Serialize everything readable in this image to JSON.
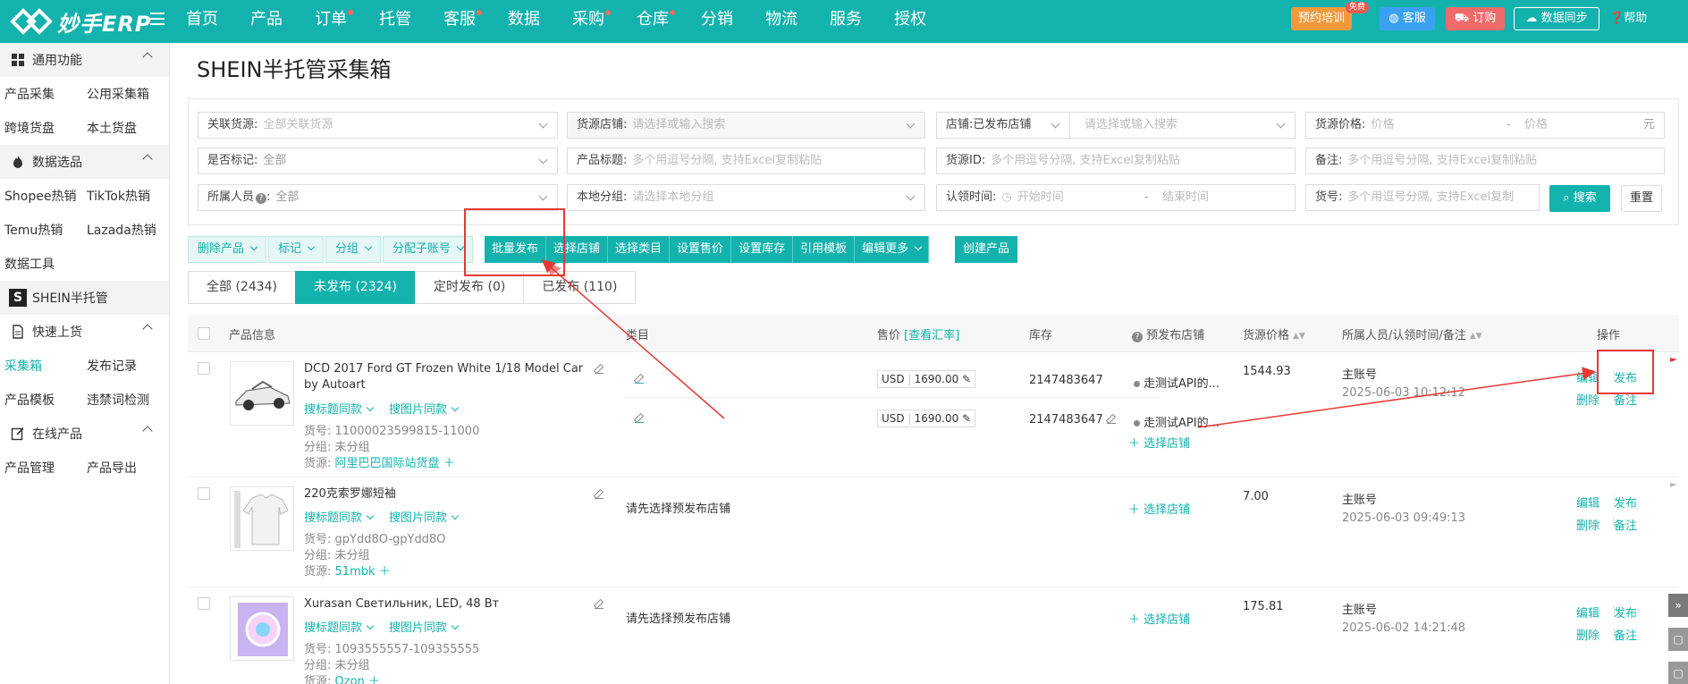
{
  "header": {
    "logo_text": "妙手ERP",
    "nav": [
      {
        "label": "首页",
        "dot": false
      },
      {
        "label": "产品",
        "dot": false
      },
      {
        "label": "订单",
        "dot": true
      },
      {
        "label": "托管",
        "dot": false
      },
      {
        "label": "客服",
        "dot": true
      },
      {
        "label": "数据",
        "dot": false
      },
      {
        "label": "采购",
        "dot": true
      },
      {
        "label": "仓库",
        "dot": true
      },
      {
        "label": "分销",
        "dot": false
      },
      {
        "label": "物流",
        "dot": false
      },
      {
        "label": "服务",
        "dot": false
      },
      {
        "label": "授权",
        "dot": false
      }
    ],
    "training_label": "预约培训",
    "free_badge": "免费",
    "kefu_label": "客服",
    "order_label": "订购",
    "sync_label": "数据同步",
    "help_label": "帮助"
  },
  "sidebar": {
    "group_common": "通用功能",
    "row1": [
      "产品采集",
      "公用采集箱"
    ],
    "row2": [
      "跨境货盘",
      "本土货盘"
    ],
    "group_data": "数据选品",
    "row3": [
      "Shopee热销",
      "TikTok热销"
    ],
    "row4": [
      "Temu热销",
      "Lazada热销"
    ],
    "data_tools": "数据工具",
    "shein_label": "SHEIN半托管",
    "shein_logo": "S",
    "group_upload": "快速上货",
    "row5": [
      "采集箱",
      "发布记录"
    ],
    "row6": [
      "产品模板",
      "违禁词检测"
    ],
    "group_online": "在线产品",
    "row7": [
      "产品管理",
      "产品导出"
    ]
  },
  "page": {
    "title": "SHEIN半托管采集箱"
  },
  "filters": {
    "source": {
      "label": "关联货源:",
      "value": "全部关联货源"
    },
    "source_shop": {
      "label": "货源店铺:",
      "placeholder": "请选择或输入搜索"
    },
    "shop": {
      "label": "店铺:",
      "value": "已发布店铺",
      "placeholder": "请选择或输入搜索"
    },
    "source_price": {
      "label": "货源价格:",
      "min_ph": "价格",
      "dash": "-",
      "max_ph": "价格",
      "unit": "元"
    },
    "marked": {
      "label": "是否标记:",
      "value": "全部"
    },
    "product_title": {
      "label": "产品标题:",
      "placeholder": "多个用逗号分隔, 支持Excel复制粘贴"
    },
    "source_id": {
      "label": "货源ID:",
      "placeholder": "多个用逗号分隔, 支持Excel复制粘贴"
    },
    "remark": {
      "label": "备注:",
      "placeholder": "多个用逗号分隔, 支持Excel复制粘贴"
    },
    "owner": {
      "label": "所属人员",
      "value": "全部"
    },
    "local_group": {
      "label": "本地分组:",
      "placeholder": "请选择本地分组"
    },
    "claim_time": {
      "label": "认领时间:",
      "start_ph": "开始时间",
      "dash": "-",
      "end_ph": "结束时间"
    },
    "sku": {
      "label": "货号:",
      "placeholder": "多个用逗号分隔, 支持Excel复制"
    },
    "search_label": "搜索",
    "reset_label": "重置"
  },
  "toolbar": {
    "light": [
      "删除产品",
      "标记",
      "分组",
      "分配子账号"
    ],
    "solid": [
      "批量发布",
      "选择店铺",
      "选择类目",
      "设置售价",
      "设置库存",
      "引用模板",
      "编辑更多"
    ],
    "create_label": "创建产品"
  },
  "tabs": [
    "全部 (2434)",
    "未发布 (2324)",
    "定时发布 (0)",
    "已发布 (110)"
  ],
  "columns": {
    "product": "产品信息",
    "category": "类目",
    "price": "售价",
    "rate_link": "[查看汇率]",
    "stock": "库存",
    "pre_shop": "预发布店铺",
    "source_price": "货源价格",
    "owner": "所属人员/认领时间/备注",
    "ops": "操作"
  },
  "rows": [
    {
      "title_line1": "DCD 2017 Ford GT Frozen White 1/18 Model Car",
      "title_line2": "by Autoart",
      "search_title": "搜标题同款",
      "search_image": "搜图片同款",
      "sku": "货号: 11000023599815-11000",
      "group": "分组: 未分组",
      "source_label": "货源:",
      "source_name": "阿里巴巴国际站货盘",
      "currency": "USD",
      "price": "1690.00",
      "stock": "2147483647",
      "shop_name": "走测试API的...",
      "select_shop": "选择店铺",
      "source_price": "1544.93",
      "owner": "主账号",
      "time": "2025-06-03 10:12:12",
      "ops": [
        "编辑",
        "发布",
        "删除",
        "备注"
      ]
    },
    {
      "title_line1": "220克索罗娜短袖",
      "search_title": "搜标题同款",
      "search_image": "搜图片同款",
      "sku": "货号: gpYdd8O-gpYdd8O",
      "group": "分组: 未分组",
      "source_label": "货源:",
      "source_name": "51mbk",
      "category_hint": "请先选择预发布店铺",
      "select_shop": "选择店铺",
      "source_price": "7.00",
      "owner": "主账号",
      "time": "2025-06-03 09:49:13",
      "ops": [
        "编辑",
        "发布",
        "删除",
        "备注"
      ]
    },
    {
      "title_line1": "Xurasan Светильник, LED, 48 Вт",
      "search_title": "搜标题同款",
      "search_image": "搜图片同款",
      "sku": "货号: 1093555557-109355555",
      "group": "分组: 未分组",
      "source_label": "货源:",
      "source_name": "Ozon",
      "category_hint": "请先选择预发布店铺",
      "select_shop": "选择店铺",
      "source_price": "175.81",
      "owner": "主账号",
      "time": "2025-06-02 14:21:48",
      "ops": [
        "编辑",
        "发布",
        "删除",
        "备注"
      ]
    }
  ],
  "colors": {
    "accent": "#14b2ad",
    "annotation_red": "#e53935"
  }
}
